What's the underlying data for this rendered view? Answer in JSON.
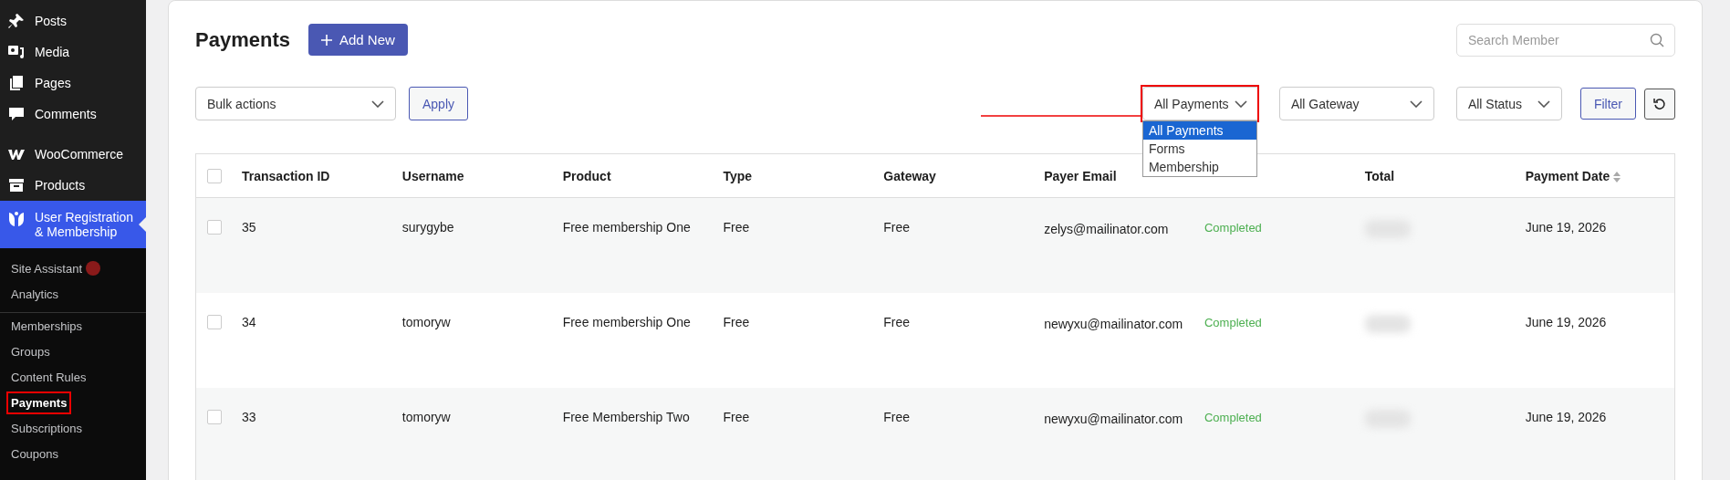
{
  "sidebar": {
    "menu": [
      {
        "label": "Posts",
        "selected": false
      },
      {
        "label": "Media",
        "selected": false
      },
      {
        "label": "Pages",
        "selected": false
      },
      {
        "label": "Comments",
        "selected": false
      },
      {
        "label": "WooCommerce",
        "selected": false
      },
      {
        "label": "Products",
        "selected": false
      },
      {
        "label": "User Registration & Membership",
        "selected": true
      }
    ],
    "submenu": [
      {
        "label": "Site Assistant",
        "badge": true,
        "selected": false,
        "highlighted": false
      },
      {
        "label": "Analytics",
        "selected": false,
        "highlighted": false
      },
      {
        "label": "Memberships",
        "selected": false,
        "highlighted": false
      },
      {
        "label": "Groups",
        "selected": false,
        "highlighted": false
      },
      {
        "label": "Content Rules",
        "selected": false,
        "highlighted": false
      },
      {
        "label": "Payments",
        "selected": true,
        "highlighted": true
      },
      {
        "label": "Subscriptions",
        "selected": false,
        "highlighted": false
      },
      {
        "label": "Coupons",
        "selected": false,
        "highlighted": false
      }
    ]
  },
  "header": {
    "title": "Payments",
    "add_button": "Add New",
    "search": {
      "placeholder": "Search Member"
    }
  },
  "toolbar": {
    "bulk_select": "Bulk actions",
    "apply_button": "Apply",
    "filters": [
      {
        "value": "All Payments",
        "highlighted": true,
        "expanded": true,
        "options": [
          {
            "label": "All Payments",
            "selected": true
          },
          {
            "label": "Forms",
            "selected": false
          },
          {
            "label": "Membership",
            "selected": false
          }
        ]
      },
      {
        "value": "All Gateway",
        "highlighted": false,
        "expanded": false
      },
      {
        "value": "All Status",
        "highlighted": false,
        "expanded": false
      }
    ],
    "filter_button": "Filter"
  },
  "table": {
    "select_all": false,
    "columns": [
      {
        "label": "Transaction ID"
      },
      {
        "label": "Username"
      },
      {
        "label": "Product"
      },
      {
        "label": "Type"
      },
      {
        "label": "Gateway"
      },
      {
        "label": "Payer Email"
      },
      {
        "kind": "status"
      },
      {
        "label": "Total"
      },
      {
        "label": "Payment Date",
        "sortable": true
      }
    ],
    "rows": [
      {
        "selected": false,
        "cells": [
          "35",
          "surygybe",
          "Free membership One",
          "Free",
          "Free",
          "zelys@mailinator.com",
          "Completed",
          null,
          "June 19, 2026"
        ]
      },
      {
        "selected": false,
        "cells": [
          "34",
          "tomoryw",
          "Free membership One",
          "Free",
          "Free",
          "newyxu@mailinator.com",
          "Completed",
          null,
          "June 19, 2026"
        ]
      },
      {
        "selected": false,
        "cells": [
          "33",
          "tomoryw",
          "Free Membership Two",
          "Free",
          "Free",
          "newyxu@mailinator.com",
          "Completed",
          null,
          "June 19, 2026"
        ]
      }
    ]
  }
}
